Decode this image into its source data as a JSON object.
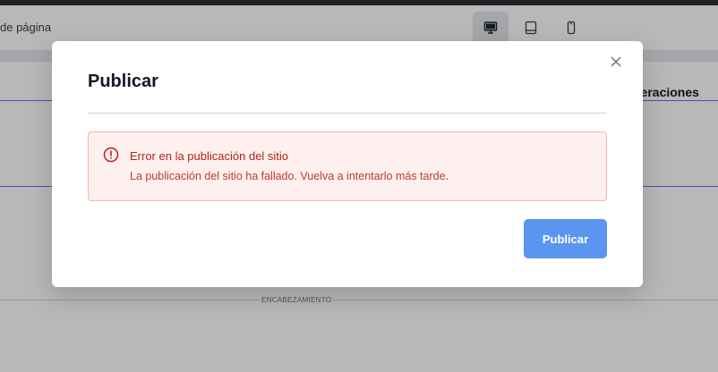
{
  "toolbar": {
    "page_label": "de página",
    "devices": [
      {
        "name": "desktop",
        "active": true
      },
      {
        "name": "tablet",
        "active": false
      },
      {
        "name": "mobile",
        "active": false
      }
    ]
  },
  "background": {
    "nav_text": "peraciones",
    "section_label": "ENCABEZAMIENTO"
  },
  "modal": {
    "title": "Publicar",
    "alert": {
      "title": "Error en la publicación del sitio",
      "message": "La publicación del sitio ha fallado. Vuelva a intentarlo más tarde.",
      "icon": "alert-circle-icon"
    },
    "publish_label": "Publicar",
    "close_icon": "close-icon"
  },
  "colors": {
    "primary": "#5b95f0",
    "error_text": "#b42318",
    "error_bg": "#fef0ef",
    "error_border": "#f4b4ad",
    "accent_line": "#8b5cf6"
  }
}
